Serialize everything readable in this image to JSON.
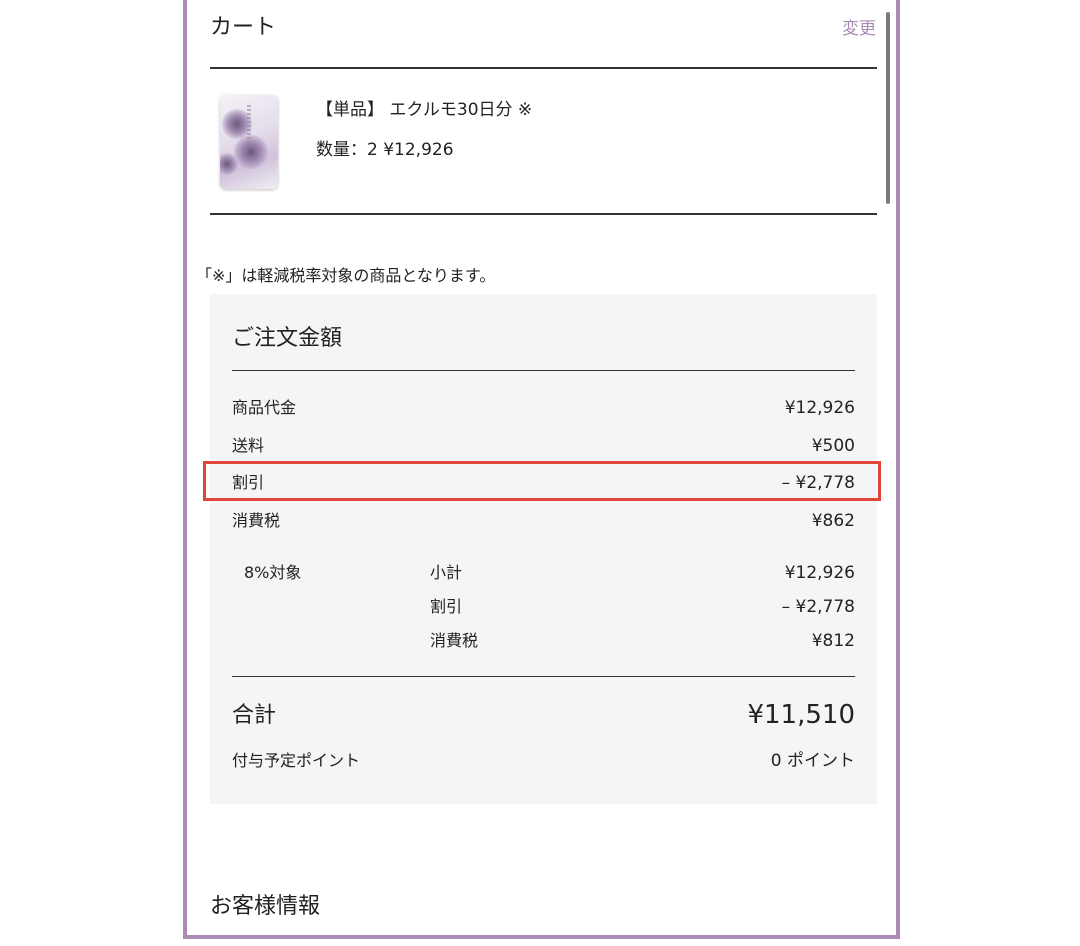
{
  "cart": {
    "title": "カート",
    "change_label": "変更",
    "item": {
      "name": "【単品】 エクルモ30日分 ※",
      "quantity_line": "数量：2 ¥12,926"
    },
    "note": "「※」は軽減税率対象の商品となります。"
  },
  "summary": {
    "title": "ご注文金額",
    "rows": [
      {
        "label": "商品代金",
        "value": "¥12,926"
      },
      {
        "label": "送料",
        "value": "¥500"
      },
      {
        "label": "割引",
        "value": "– ¥2,778"
      },
      {
        "label": "消費税",
        "value": "¥862"
      }
    ],
    "tax_group": {
      "label": "8%対象",
      "rows": [
        {
          "label": "小計",
          "value": "¥12,926"
        },
        {
          "label": "割引",
          "value": "– ¥2,778"
        },
        {
          "label": "消費税",
          "value": "¥812"
        }
      ]
    },
    "total_label": "合計",
    "total_value": "¥11,510",
    "points_label": "付与予定ポイント",
    "points_value": "0 ポイント"
  },
  "customer": {
    "title": "お客様情報"
  },
  "colors": {
    "frame_border": "#a98bb3",
    "accent_link": "#a98bb3",
    "highlight_border": "#e0463a",
    "summary_bg": "#f3f5f6"
  }
}
